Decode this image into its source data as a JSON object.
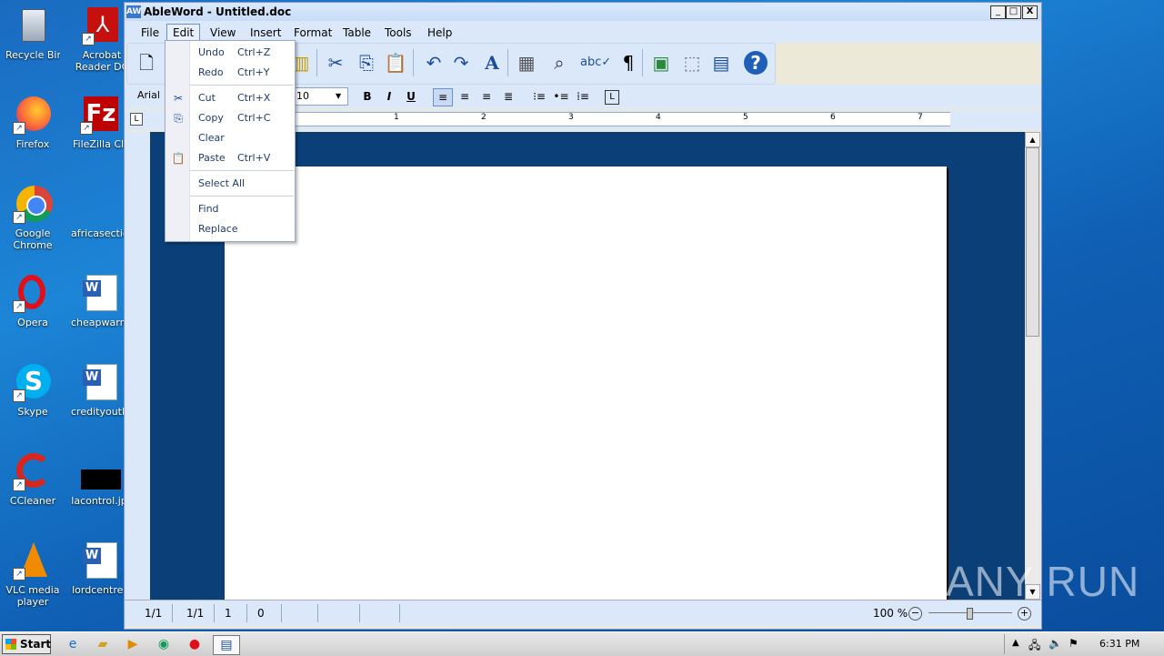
{
  "desktop": {
    "icons": [
      {
        "label": "Recycle Bin",
        "icon": "recycle-bin-icon"
      },
      {
        "label": "Acrobat Reader DC",
        "icon": "acrobat-icon"
      },
      {
        "label": "Firefox",
        "icon": "firefox-icon"
      },
      {
        "label": "FileZilla Clie",
        "icon": "filezilla-icon"
      },
      {
        "label": "Google Chrome",
        "icon": "chrome-icon"
      },
      {
        "label": "africasectio",
        "icon": "file-icon"
      },
      {
        "label": "Opera",
        "icon": "opera-icon"
      },
      {
        "label": "cheapwarni",
        "icon": "word-doc-icon"
      },
      {
        "label": "Skype",
        "icon": "skype-icon"
      },
      {
        "label": "credityouth.",
        "icon": "word-doc-icon"
      },
      {
        "label": "CCleaner",
        "icon": "ccleaner-icon"
      },
      {
        "label": "lacontrol.jp",
        "icon": "image-file-icon"
      },
      {
        "label": "VLC media player",
        "icon": "vlc-icon"
      },
      {
        "label": "lordcentre.",
        "icon": "word-doc-icon"
      }
    ]
  },
  "window": {
    "app_icon": "AW",
    "title": "AbleWord - Untitled.doc",
    "controls": {
      "minimize": "_",
      "maximize": "□",
      "close": "X"
    }
  },
  "menubar": {
    "items": [
      "File",
      "Edit",
      "View",
      "Insert",
      "Format",
      "Table",
      "Tools",
      "Help"
    ],
    "active": "Edit"
  },
  "edit_menu": {
    "undo": {
      "label": "Undo",
      "shortcut": "Ctrl+Z"
    },
    "redo": {
      "label": "Redo",
      "shortcut": "Ctrl+Y"
    },
    "cut": {
      "label": "Cut",
      "shortcut": "Ctrl+X"
    },
    "copy": {
      "label": "Copy",
      "shortcut": "Ctrl+C"
    },
    "clear": {
      "label": "Clear"
    },
    "paste": {
      "label": "Paste",
      "shortcut": "Ctrl+V"
    },
    "select_all": {
      "label": "Select All"
    },
    "find": {
      "label": "Find"
    },
    "replace": {
      "label": "Replace"
    }
  },
  "format_bar": {
    "font": "Arial",
    "size": "10",
    "bold": "B",
    "italic": "I",
    "underline": "U"
  },
  "ruler": {
    "ticks": [
      "1",
      "2",
      "3",
      "4",
      "5",
      "6",
      "7"
    ]
  },
  "status": {
    "page": "1/1",
    "section": "1/1",
    "line": "1",
    "col": "0",
    "zoom": "100 %",
    "zoom_minus": "−",
    "zoom_plus": "+"
  },
  "taskbar": {
    "start_label": "Start",
    "clock": "6:31 PM"
  },
  "watermark": "ANY RUN"
}
